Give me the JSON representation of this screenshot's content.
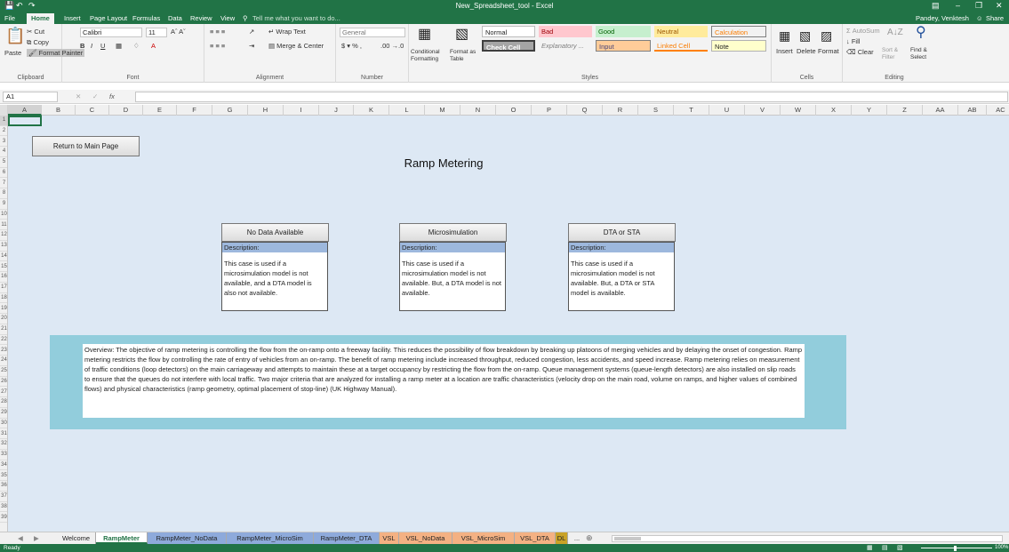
{
  "window": {
    "title": "New_Spreadsheet_tool - Excel",
    "user": "Pandey, Venktesh",
    "share": "Share"
  },
  "ribbon_tabs": [
    "File",
    "Home",
    "Insert",
    "Page Layout",
    "Formulas",
    "Data",
    "Review",
    "View"
  ],
  "tell_me": "Tell me what you want to do...",
  "clipboard": {
    "paste": "Paste",
    "cut": "Cut",
    "copy": "Copy",
    "format_painter": "Format Painter",
    "label": "Clipboard"
  },
  "font": {
    "name": "Calibri",
    "size": "11",
    "label": "Font"
  },
  "alignment": {
    "wrap": "Wrap Text",
    "merge": "Merge & Center",
    "label": "Alignment"
  },
  "number": {
    "format": "General",
    "label": "Number"
  },
  "styles_group": {
    "conditional": "Conditional Formatting",
    "format_table": "Format as Table",
    "label": "Styles",
    "cells": [
      "Normal",
      "Bad",
      "Good",
      "Neutral",
      "Calculation",
      "Check Cell",
      "Explanatory ...",
      "Input",
      "Linked Cell",
      "Note"
    ]
  },
  "cells_group": {
    "insert": "Insert",
    "delete": "Delete",
    "format": "Format",
    "label": "Cells"
  },
  "editing": {
    "autosum": "AutoSum",
    "fill": "Fill",
    "clear": "Clear",
    "sort": "Sort & Filter",
    "find": "Find & Select",
    "label": "Editing"
  },
  "formula_bar": {
    "name_box": "A1",
    "fx": "fx",
    "value": ""
  },
  "columns": [
    "A",
    "B",
    "C",
    "D",
    "E",
    "F",
    "G",
    "H",
    "I",
    "J",
    "K",
    "L",
    "M",
    "N",
    "O",
    "P",
    "Q",
    "R",
    "S",
    "T",
    "U",
    "V",
    "W",
    "X",
    "Y",
    "Z",
    "AA",
    "AB",
    "AC"
  ],
  "page": {
    "return_button": "Return to Main Page",
    "title": "Ramp Metering",
    "options": [
      {
        "button": "No Data Available",
        "desc_header": "Description:",
        "desc": "This case is used if a microsimulation model is not available, and a DTA model is also not available."
      },
      {
        "button": "Microsimulation",
        "desc_header": "Description:",
        "desc": "This case is used if a microsimulation model is not available. But, a DTA model is not available."
      },
      {
        "button": "DTA or STA",
        "desc_header": "Description:",
        "desc": "This case is used if a microsimulation model is not available. But, a DTA or STA model is available."
      }
    ],
    "overview": "Overview: The objective of ramp metering is controlling the flow from the on-ramp onto a freeway facility. This reduces the possibility of flow breakdown by breaking up platoons of merging vehicles and by delaying the onset of congestion. Ramp metering restricts the flow by controlling the rate of entry of vehicles from an on-ramp. The benefit of ramp metering include increased throughput, reduced congestion, less accidents, and speed increase. Ramp metering relies on measurement of traffic conditions (loop detectors) on the main carriageway and attempts to maintain these at a target occupancy by restricting the flow from the on-ramp. Queue management systems (queue-length detectors) are also installed on slip roads to ensure that the queues do not interfere with local traffic. Two major criteria that are analyzed for installing a ramp meter at a location are traffic characteristics (velocity drop on the main road, volume on ramps, and higher values of combined flows) and physical characteristics (ramp geometry, optimal placement of stop-line) (UK Highway Manual)."
  },
  "sheet_tabs": [
    "Welcome",
    "RampMeter",
    "RampMeter_NoData",
    "RampMeter_MicroSim",
    "RampMeter_DTA",
    "VSL",
    "VSL_NoData",
    "VSL_MicroSim",
    "VSL_DTA",
    "DL",
    "..."
  ],
  "status": {
    "ready": "Ready",
    "zoom": "100%"
  },
  "colors": {
    "excel_green": "#217346",
    "grid_bg": "#dde8f4",
    "overview_bg": "#92cddc",
    "desc_header": "#9db8dd"
  }
}
